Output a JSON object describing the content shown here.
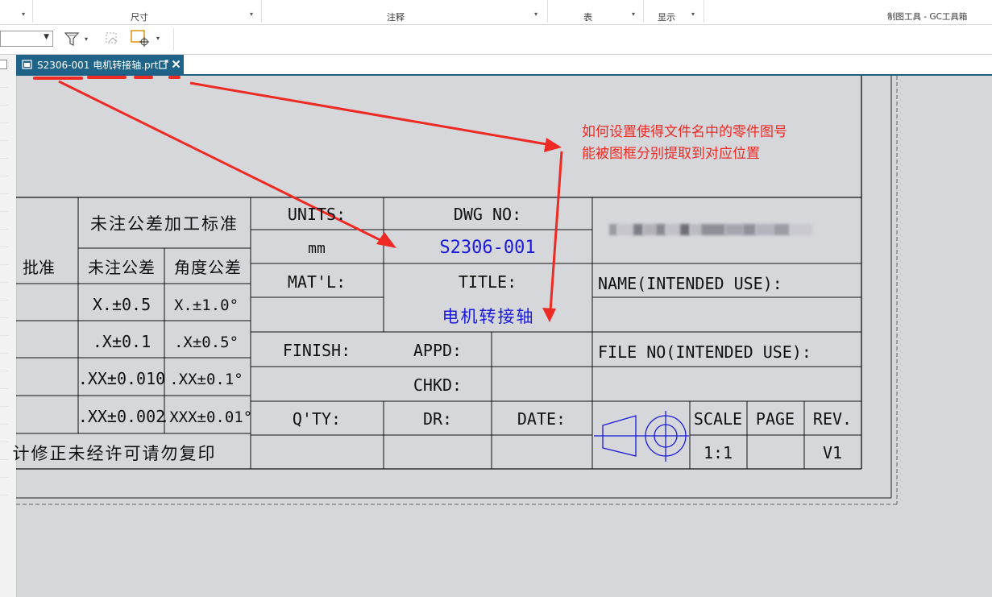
{
  "ribbon": {
    "groups": [
      "尺寸",
      "注释",
      "表",
      "显示"
    ],
    "right_title": "制图工具 - GC工具箱"
  },
  "tab": {
    "title": "S2306-001 电机转接轴.prt"
  },
  "title_block": {
    "tolerance_header": "未注公差加工标准",
    "approve": "批准",
    "col_linear": "未注公差",
    "col_angular": "角度公差",
    "tol_rows": [
      [
        "X.±0.5",
        "X.±1.0°"
      ],
      [
        ".X±0.1",
        ".X±0.5°"
      ],
      [
        ".XX±0.010",
        ".XX±0.1°"
      ],
      [
        ".XX±0.002",
        ".XXX±0.01°"
      ]
    ],
    "footer_note": "计修正未经许可请勿复印",
    "units_label": "UNITS:",
    "units_value": "mm",
    "dwg_no_label": "DWG NO:",
    "dwg_no_value": "S2306-001",
    "matl_label": "MAT'L:",
    "title_label": "TITLE:",
    "title_value": "电机转接轴",
    "finish_label": "FINISH:",
    "appd_label": "APPD:",
    "chkd_label": "CHKD:",
    "qty_label": "Q'TY:",
    "dr_label": "DR:",
    "date_label": "DATE:",
    "name_label": "NAME(INTENDED USE):",
    "file_no_label": "FILE NO(INTENDED USE):",
    "scale_label": "SCALE",
    "scale_value": "1:1",
    "page_label": "PAGE",
    "rev_label": "REV.",
    "rev_value": "V1"
  },
  "annotation": {
    "line1": "如何设置使得文件名中的零件图号",
    "line2": "能被图框分别提取到对应位置"
  },
  "colors": {
    "drawing_blue": "#1a1adc",
    "annotation_red": "#ee2a24",
    "tab_blue": "#1f6388"
  }
}
